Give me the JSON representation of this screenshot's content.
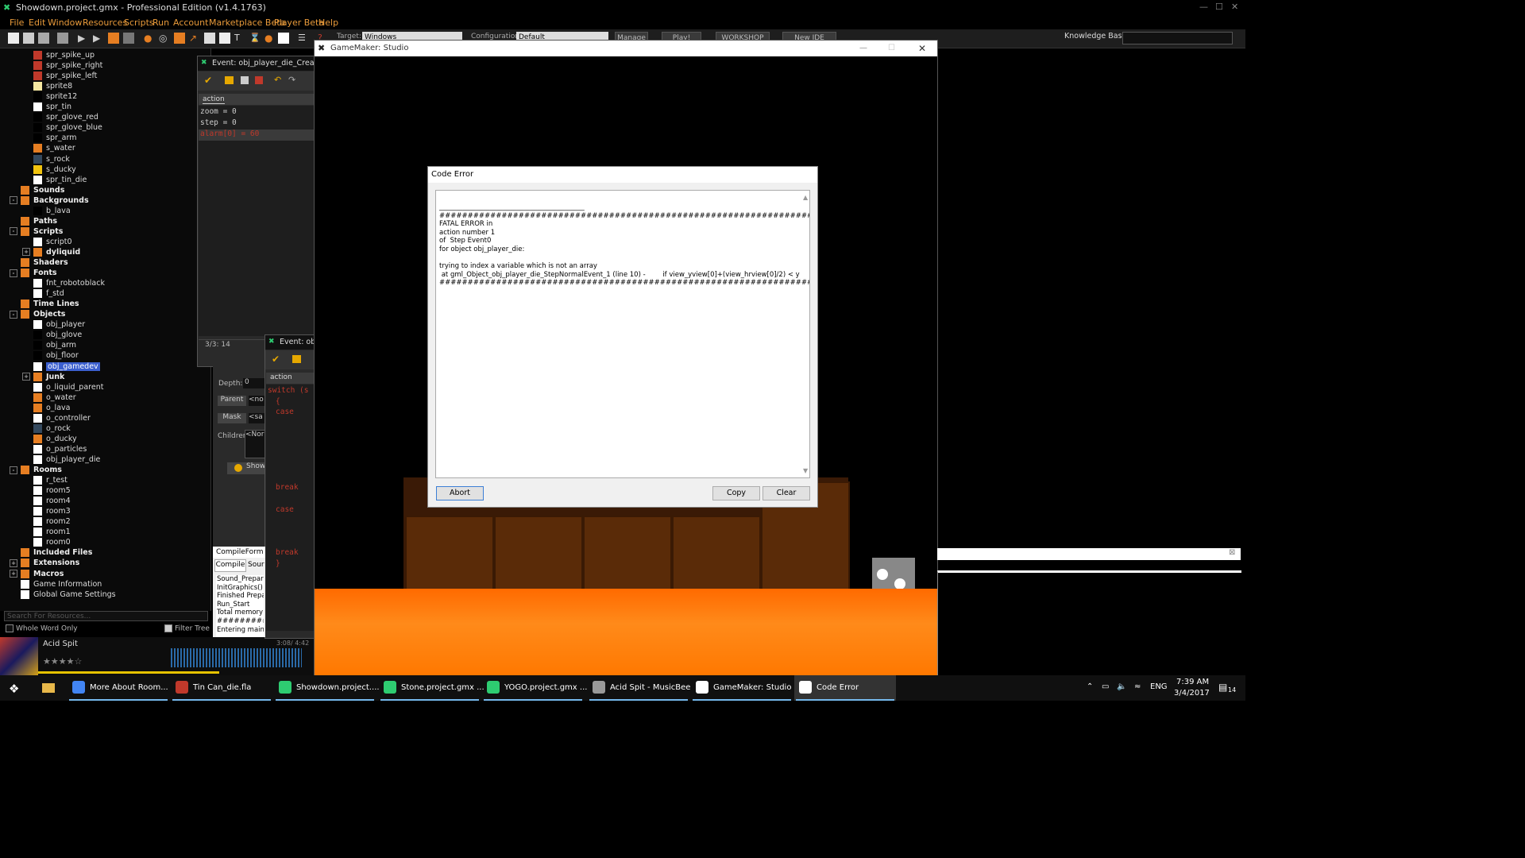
{
  "titlebar": {
    "title": "Showdown.project.gmx  -  Professional Edition (v1.4.1763)"
  },
  "menu": [
    "File",
    "Edit",
    "Window",
    "Resources",
    "Scripts",
    "Run",
    "Account",
    "Marketplace Beta",
    "Player Beta",
    "Help"
  ],
  "toolbar": {
    "target_label": "Target:",
    "target_value": "Windows",
    "config_label": "Configuration:",
    "config_value": "Default",
    "manage": "Manage",
    "play": "Play!",
    "workshop": "WORKSHOP",
    "new_ide": "New IDE",
    "kb_label": "Knowledge Base:"
  },
  "tree": [
    {
      "label": "spr_spike_up",
      "lvl": 2,
      "color": "#c0392b"
    },
    {
      "label": "spr_spike_right",
      "lvl": 2,
      "color": "#c0392b"
    },
    {
      "label": "spr_spike_left",
      "lvl": 2,
      "color": "#c0392b"
    },
    {
      "label": "sprite8",
      "lvl": 2,
      "color": "#f5e7a0"
    },
    {
      "label": "sprite12",
      "lvl": 2,
      "color": "#000"
    },
    {
      "label": "spr_tin",
      "lvl": 2,
      "color": "#fff"
    },
    {
      "label": "spr_glove_red",
      "lvl": 2,
      "color": "#000"
    },
    {
      "label": "spr_glove_blue",
      "lvl": 2,
      "color": "#000"
    },
    {
      "label": "spr_arm",
      "lvl": 2,
      "color": "#000"
    },
    {
      "label": "s_water",
      "lvl": 2,
      "color": "#e67e22"
    },
    {
      "label": "s_rock",
      "lvl": 2,
      "color": "#34495e"
    },
    {
      "label": "s_ducky",
      "lvl": 2,
      "color": "#f1c40f"
    },
    {
      "label": "spr_tin_die",
      "lvl": 2,
      "color": "#fff"
    },
    {
      "label": "Sounds",
      "lvl": 1,
      "folder": true
    },
    {
      "label": "Backgrounds",
      "lvl": 1,
      "folder": true,
      "exp": "-"
    },
    {
      "label": "b_lava",
      "lvl": 2,
      "color": "#000"
    },
    {
      "label": "Paths",
      "lvl": 1,
      "folder": true
    },
    {
      "label": "Scripts",
      "lvl": 1,
      "folder": true,
      "exp": "-"
    },
    {
      "label": "script0",
      "lvl": 2,
      "color": "#fff"
    },
    {
      "label": "dyliquid",
      "lvl": 2,
      "folder": true,
      "exp": "+"
    },
    {
      "label": "Shaders",
      "lvl": 1,
      "folder": true
    },
    {
      "label": "Fonts",
      "lvl": 1,
      "folder": true,
      "exp": "-"
    },
    {
      "label": "fnt_robotoblack",
      "lvl": 2,
      "color": "#fff"
    },
    {
      "label": "f_std",
      "lvl": 2,
      "color": "#fff"
    },
    {
      "label": "Time Lines",
      "lvl": 1,
      "folder": true
    },
    {
      "label": "Objects",
      "lvl": 1,
      "folder": true,
      "exp": "-"
    },
    {
      "label": "obj_player",
      "lvl": 2,
      "color": "#fff"
    },
    {
      "label": "obj_glove",
      "lvl": 2,
      "color": "#000"
    },
    {
      "label": "obj_arm",
      "lvl": 2,
      "color": "#000"
    },
    {
      "label": "obj_floor",
      "lvl": 2,
      "color": "#000"
    },
    {
      "label": "obj_gamedev",
      "lvl": 2,
      "color": "#fff",
      "selected": true
    },
    {
      "label": "Junk",
      "lvl": 2,
      "folder": true,
      "exp": "+"
    },
    {
      "label": "o_liquid_parent",
      "lvl": 2,
      "color": "#fff"
    },
    {
      "label": "o_water",
      "lvl": 2,
      "color": "#e67e22"
    },
    {
      "label": "o_lava",
      "lvl": 2,
      "color": "#e67e22"
    },
    {
      "label": "o_controller",
      "lvl": 2,
      "color": "#fff"
    },
    {
      "label": "o_rock",
      "lvl": 2,
      "color": "#34495e"
    },
    {
      "label": "o_ducky",
      "lvl": 2,
      "color": "#e67e22"
    },
    {
      "label": "o_particles",
      "lvl": 2,
      "color": "#fff"
    },
    {
      "label": "obj_player_die",
      "lvl": 2,
      "color": "#fff"
    },
    {
      "label": "Rooms",
      "lvl": 1,
      "folder": true,
      "exp": "-"
    },
    {
      "label": "r_test",
      "lvl": 2,
      "color": "#fff"
    },
    {
      "label": "room5",
      "lvl": 2,
      "color": "#fff"
    },
    {
      "label": "room4",
      "lvl": 2,
      "color": "#fff"
    },
    {
      "label": "room3",
      "lvl": 2,
      "color": "#fff"
    },
    {
      "label": "room2",
      "lvl": 2,
      "color": "#fff"
    },
    {
      "label": "room1",
      "lvl": 2,
      "color": "#fff"
    },
    {
      "label": "room0",
      "lvl": 2,
      "color": "#fff"
    },
    {
      "label": "Included Files",
      "lvl": 1,
      "folder": true
    },
    {
      "label": "Extensions",
      "lvl": 1,
      "folder": true,
      "exp": "+"
    },
    {
      "label": "Macros",
      "lvl": 1,
      "folder": true,
      "exp": "+"
    },
    {
      "label": "Game Information",
      "lvl": 1,
      "color": "#fff"
    },
    {
      "label": "Global Game Settings",
      "lvl": 1,
      "color": "#fff"
    }
  ],
  "tree_search": {
    "placeholder": "Search For Resources...",
    "whole_word": "Whole Word Only",
    "filter_tree": "Filter Tree"
  },
  "music": {
    "track": "Acid Spit",
    "time": "3:08/ 4:42"
  },
  "event1": {
    "title": "Event: obj_player_die_Create_",
    "tab": "action",
    "lines": [
      "zoom = 0",
      "step = 0",
      "alarm[0] = 60"
    ],
    "status": "3/3: 14"
  },
  "event2": {
    "title": "Event: obj",
    "tab": "action",
    "lines": [
      "switch (s",
      "{",
      "case",
      "",
      "",
      "",
      "",
      "",
      "",
      "break",
      "",
      "case",
      "",
      "",
      "",
      "break",
      "}"
    ]
  },
  "objprops": {
    "depth_label": "Depth:",
    "depth_value": "0",
    "parent_btn": "Parent",
    "parent_value": "<no",
    "mask_btn": "Mask",
    "mask_value": "<sa",
    "children_label": "Children:",
    "children_value": "<Nor",
    "show_btn": "Show"
  },
  "compile": {
    "title": "CompileForm",
    "tab1": "Compile",
    "tab2": "Sour",
    "lines": [
      "Sound_Prepar",
      "InitGraphics()",
      "Finished Prepa",
      "Run_Start",
      "Total memory u",
      "##########",
      "Entering main l"
    ]
  },
  "gm_window": {
    "title": "GameMaker: Studio"
  },
  "dialog": {
    "title": "Code Error",
    "message": "___________________________________________\n############################################################################################\nFATAL ERROR in\naction number 1\nof  Step Event0\nfor object obj_player_die:\n\ntrying to index a variable which is not an array\n at gml_Object_obj_player_die_StepNormalEvent_1 (line 10) -        if view_yview[0]+(view_hrview[0]/2) < y\n############################################################################################",
    "abort": "Abort",
    "copy": "Copy",
    "clear": "Clear"
  },
  "taskbar": {
    "items": [
      {
        "label": "More About Room...",
        "color": "#4285f4"
      },
      {
        "label": "Tin Can_die.fla",
        "color": "#c0392b"
      },
      {
        "label": "Showdown.project....",
        "color": "#2ecc71"
      },
      {
        "label": "Stone.project.gmx ...",
        "color": "#2ecc71"
      },
      {
        "label": "YOGO.project.gmx ...",
        "color": "#2ecc71"
      },
      {
        "label": "Acid Spit - MusicBee",
        "color": "#999"
      },
      {
        "label": "GameMaker: Studio",
        "color": "#fff"
      },
      {
        "label": "Code Error",
        "color": "#fff"
      }
    ],
    "lang": "ENG",
    "time": "7:39 AM",
    "date": "3/4/2017",
    "notif": "14"
  }
}
